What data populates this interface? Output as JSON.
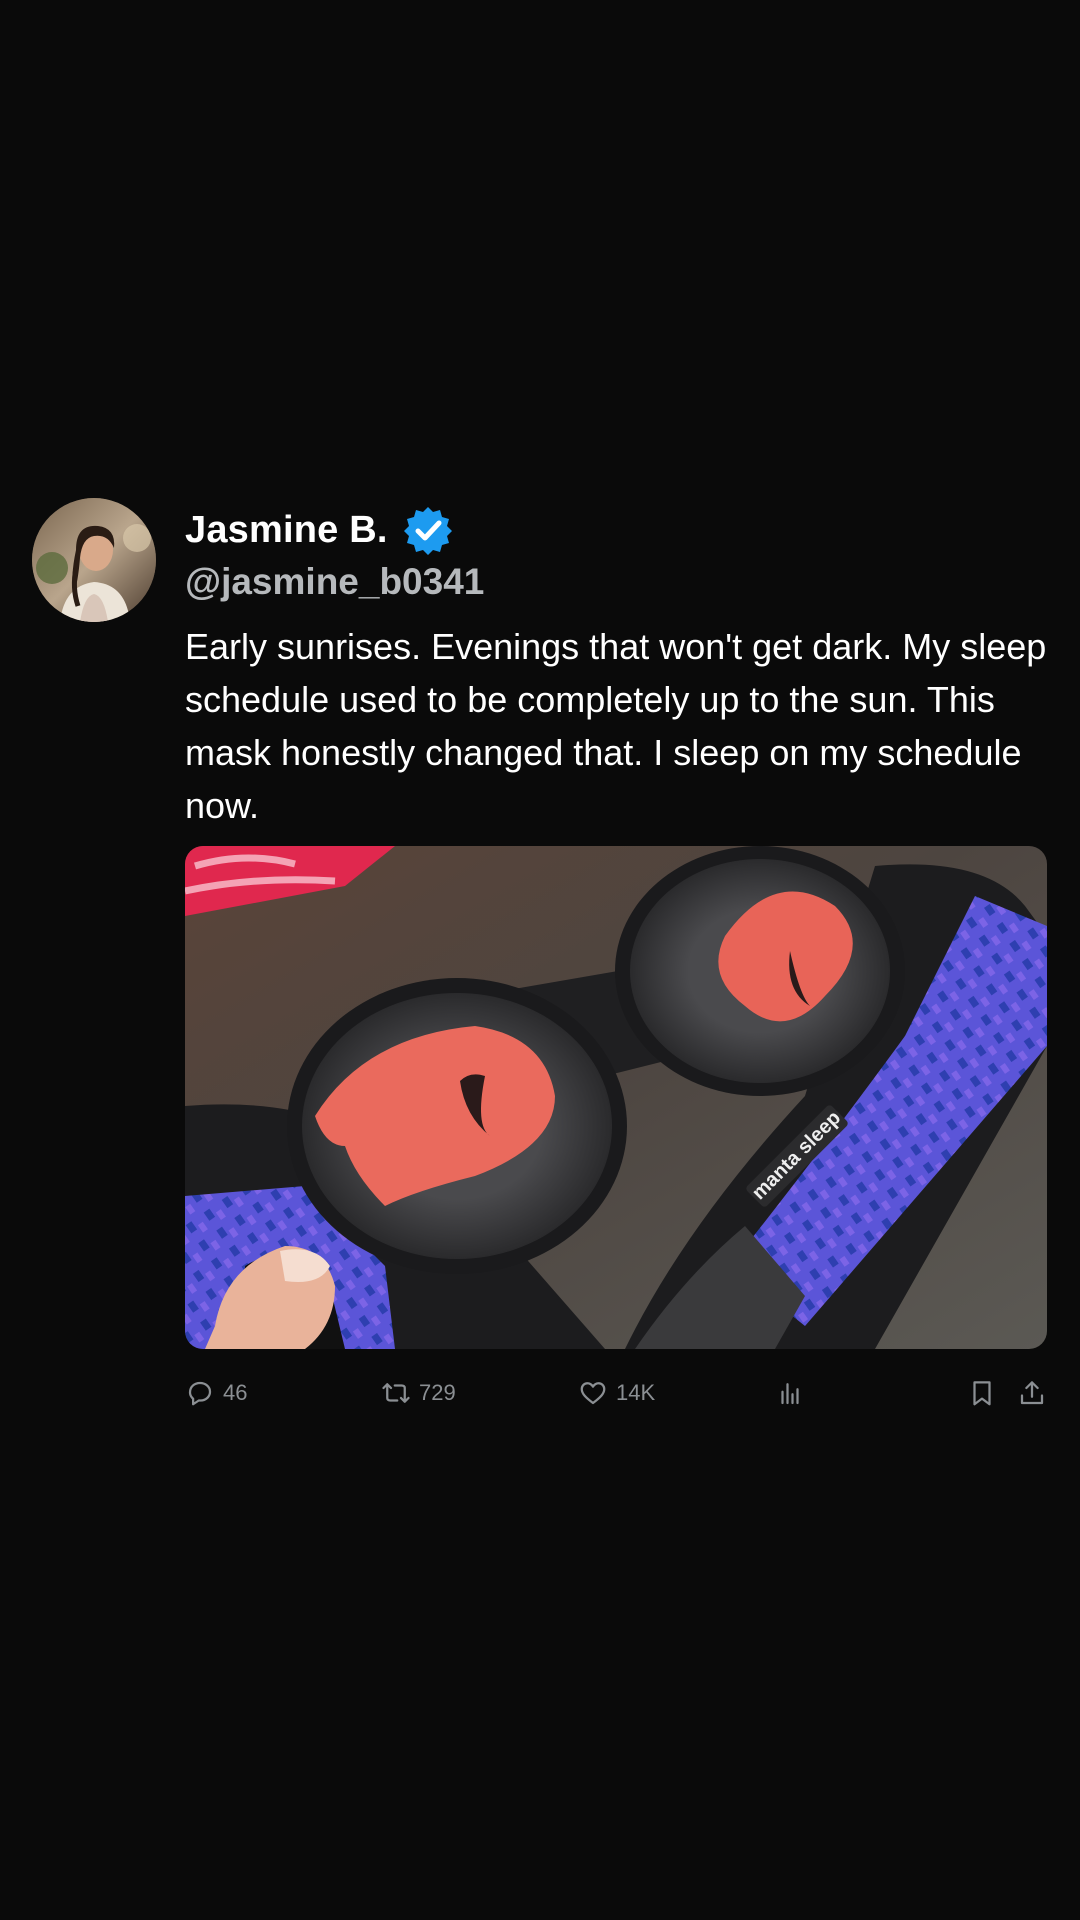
{
  "post": {
    "author": {
      "display_name": "Jasmine B.",
      "handle": "@jasmine_b0341",
      "verified": true,
      "verified_color": "#1d9bf0"
    },
    "text": "Early sunrises. Evenings that won't get dark. My sleep schedule used to be completely up to the sun. This mask honestly changed that. I sleep on my schedule now.",
    "media": {
      "product_label": "manta sleep"
    },
    "actions": {
      "replies": "46",
      "reposts": "729",
      "likes": "14K"
    },
    "icons": {
      "reply": "reply-icon",
      "repost": "repost-icon",
      "like": "heart-icon",
      "views": "views-chart-icon",
      "bookmark": "bookmark-icon",
      "share": "share-icon"
    }
  },
  "colors": {
    "background": "#0a0a0a",
    "text_primary": "#ffffff",
    "text_secondary": "#8b8f93",
    "accent": "#1d9bf0"
  }
}
